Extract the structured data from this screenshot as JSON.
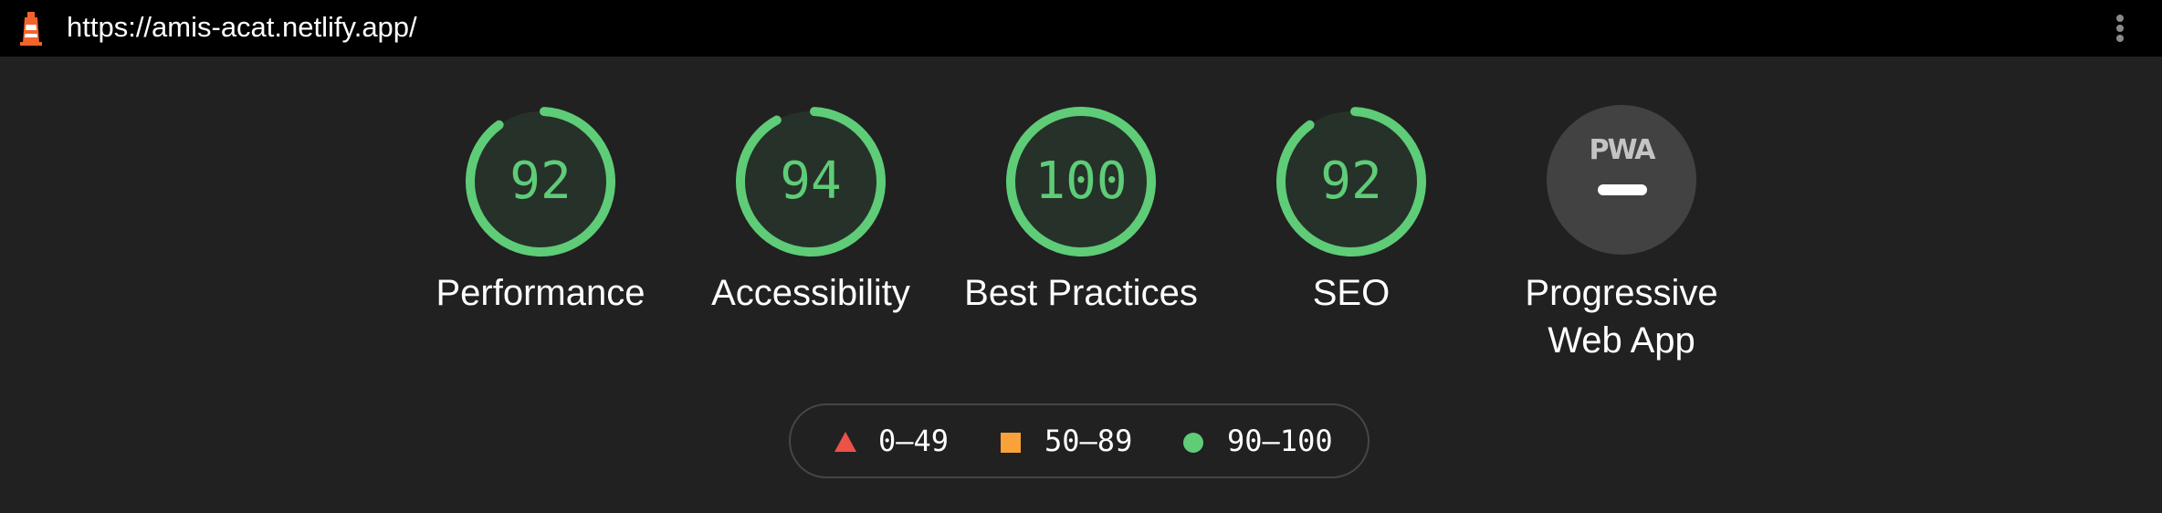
{
  "topbar": {
    "url": "https://amis-acat.netlify.app/",
    "logo_icon": "lighthouse-icon",
    "menu_icon": "more-vert-icon"
  },
  "gauges": [
    {
      "label": "Performance",
      "value": "92",
      "score": 0.92,
      "color": "#5fcc78"
    },
    {
      "label": "Accessibility",
      "value": "94",
      "score": 0.94,
      "color": "#5fcc78"
    },
    {
      "label": "Best Practices",
      "value": "100",
      "score": 1.0,
      "color": "#5fcc78"
    },
    {
      "label": "SEO",
      "value": "92",
      "score": 0.92,
      "color": "#5fcc78"
    }
  ],
  "pwa": {
    "badge": "PWA",
    "label_line1": "Progressive",
    "label_line2": "Web App"
  },
  "legend": [
    {
      "range": "0–49",
      "shape": "triangle",
      "color": "#ec5247"
    },
    {
      "range": "50–89",
      "shape": "square",
      "color": "#f9a23a"
    },
    {
      "range": "90–100",
      "shape": "circle",
      "color": "#5fcc78"
    }
  ]
}
